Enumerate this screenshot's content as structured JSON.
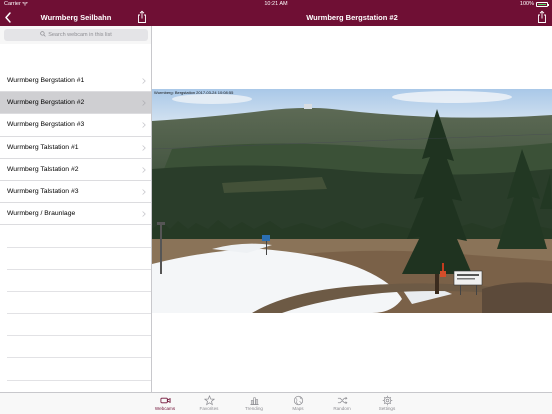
{
  "status_bar": {
    "carrier": "Carrier",
    "time": "10:21 AM",
    "battery": "100%"
  },
  "nav": {
    "left_title": "Wurmberg Seilbahn",
    "right_title": "Wurmberg Bergstation #2",
    "back_icon": "chevron-left-icon",
    "share_icon": "share-icon"
  },
  "search": {
    "placeholder": "Search webcam in this list"
  },
  "webcams": [
    {
      "label": "Wurmberg Bergstation #1",
      "selected": false
    },
    {
      "label": "Wurmberg Bergstation #2",
      "selected": true
    },
    {
      "label": "Wurmberg Bergstation #3",
      "selected": false
    },
    {
      "label": "Wurmberg Talstation #1",
      "selected": false
    },
    {
      "label": "Wurmberg Talstation #2",
      "selected": false
    },
    {
      "label": "Wurmberg Talstation #3",
      "selected": false
    },
    {
      "label": "Wurmberg / Braunlage",
      "selected": false
    }
  ],
  "webcam_image": {
    "timestamp_overlay": "Wurmberg: Bergstation 2017-03-24 10:08:55"
  },
  "tabs": [
    {
      "label": "Webcams",
      "icon": "video-camera-icon",
      "active": true
    },
    {
      "label": "Favorites",
      "icon": "star-icon",
      "active": false
    },
    {
      "label": "Trending",
      "icon": "bar-chart-icon",
      "active": false
    },
    {
      "label": "Maps",
      "icon": "globe-icon",
      "active": false
    },
    {
      "label": "Random",
      "icon": "shuffle-icon",
      "active": false
    },
    {
      "label": "Settings",
      "icon": "gear-icon",
      "active": false
    }
  ],
  "colors": {
    "brand": "#6f0f34",
    "selected_row": "#cfcfd2",
    "battery": "#4cd964"
  }
}
